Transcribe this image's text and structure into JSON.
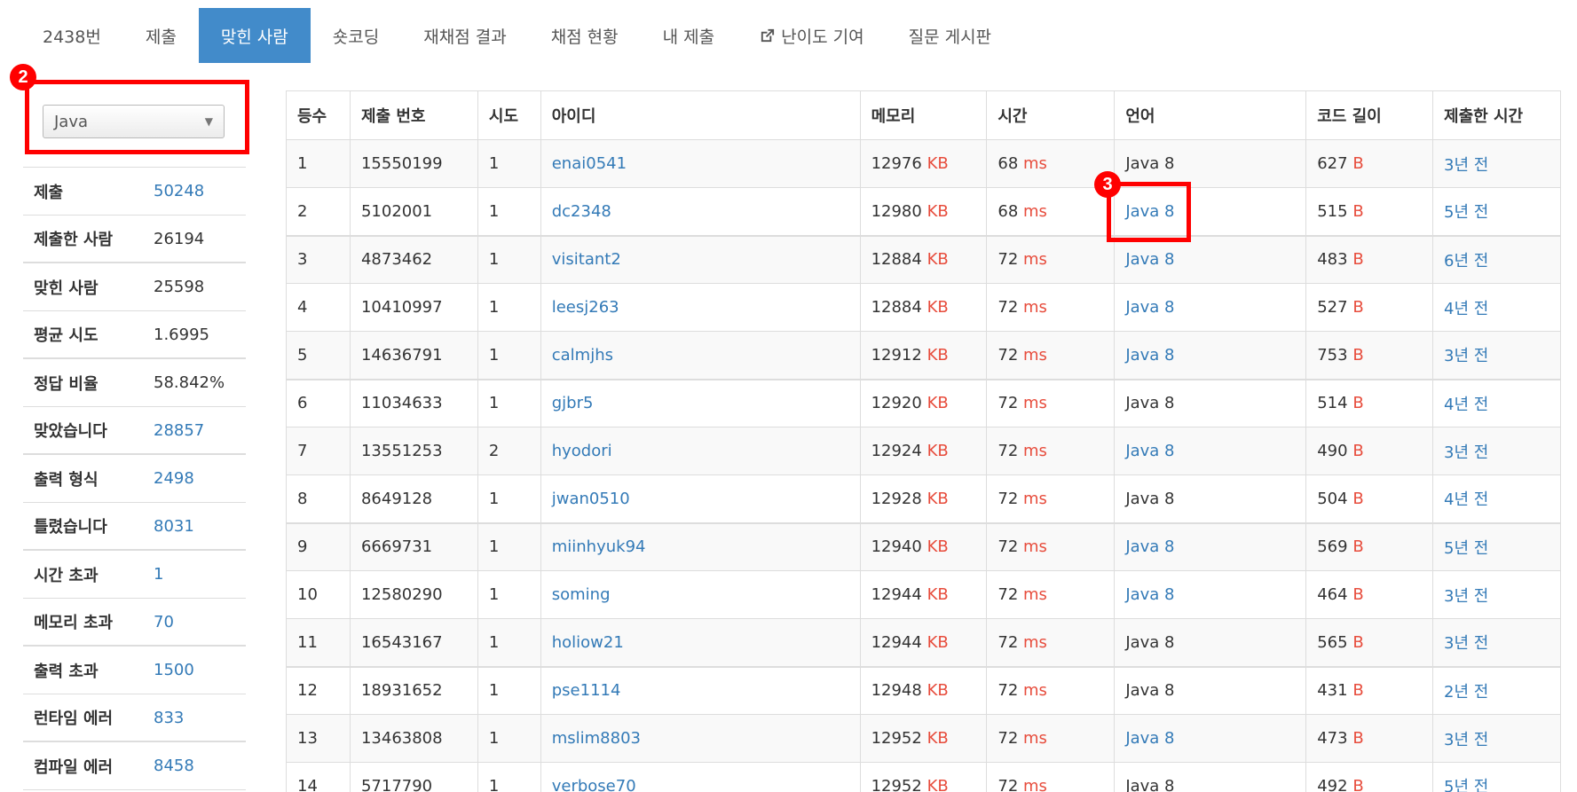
{
  "nav": {
    "tabs": [
      {
        "label": "2438번"
      },
      {
        "label": "제출"
      },
      {
        "label": "맞힌 사람"
      },
      {
        "label": "숏코딩"
      },
      {
        "label": "재채점 결과"
      },
      {
        "label": "채점 현황"
      },
      {
        "label": "내 제출"
      },
      {
        "label": "난이도 기여",
        "icon": "external-link-icon"
      },
      {
        "label": "질문 게시판"
      }
    ],
    "active": "맞힌 사람"
  },
  "language_filter": {
    "selected": "Java"
  },
  "stats": [
    {
      "label": "제출",
      "value": "50248",
      "link": true
    },
    {
      "label": "제출한 사람",
      "value": "26194",
      "link": false
    },
    {
      "label": "맞힌 사람",
      "value": "25598",
      "link": false
    },
    {
      "label": "평균 시도",
      "value": "1.6995",
      "link": false
    },
    {
      "label": "정답 비율",
      "value": "58.842%",
      "link": false
    },
    {
      "label": "맞았습니다",
      "value": "28857",
      "link": true
    },
    {
      "label": "출력 형식",
      "value": "2498",
      "link": true
    },
    {
      "label": "틀렸습니다",
      "value": "8031",
      "link": true
    },
    {
      "label": "시간 초과",
      "value": "1",
      "link": true
    },
    {
      "label": "메모리 초과",
      "value": "70",
      "link": true
    },
    {
      "label": "출력 초과",
      "value": "1500",
      "link": true
    },
    {
      "label": "런타임 에러",
      "value": "833",
      "link": true
    },
    {
      "label": "컴파일 에러",
      "value": "8458",
      "link": true
    }
  ],
  "table": {
    "headers": [
      "등수",
      "제출 번호",
      "시도",
      "아이디",
      "메모리",
      "시간",
      "언어",
      "코드 길이",
      "제출한 시간"
    ],
    "units": {
      "memory": "KB",
      "time": "ms",
      "code": "B"
    },
    "rows": [
      {
        "rank": "1",
        "submission": "15550199",
        "tries": "1",
        "user": "enai0541",
        "memory": "12976",
        "time": "68",
        "lang": "Java 8",
        "lang_link": false,
        "code": "627",
        "when": "3년 전"
      },
      {
        "rank": "2",
        "submission": "5102001",
        "tries": "1",
        "user": "dc2348",
        "memory": "12980",
        "time": "68",
        "lang": "Java 8",
        "lang_link": true,
        "code": "515",
        "when": "5년 전"
      },
      {
        "rank": "3",
        "submission": "4873462",
        "tries": "1",
        "user": "visitant2",
        "memory": "12884",
        "time": "72",
        "lang": "Java 8",
        "lang_link": true,
        "code": "483",
        "when": "6년 전"
      },
      {
        "rank": "4",
        "submission": "10410997",
        "tries": "1",
        "user": "leesj263",
        "memory": "12884",
        "time": "72",
        "lang": "Java 8",
        "lang_link": true,
        "code": "527",
        "when": "4년 전"
      },
      {
        "rank": "5",
        "submission": "14636791",
        "tries": "1",
        "user": "calmjhs",
        "memory": "12912",
        "time": "72",
        "lang": "Java 8",
        "lang_link": true,
        "code": "753",
        "when": "3년 전"
      },
      {
        "rank": "6",
        "submission": "11034633",
        "tries": "1",
        "user": "gjbr5",
        "memory": "12920",
        "time": "72",
        "lang": "Java 8",
        "lang_link": false,
        "code": "514",
        "when": "4년 전"
      },
      {
        "rank": "7",
        "submission": "13551253",
        "tries": "2",
        "user": "hyodori",
        "memory": "12924",
        "time": "72",
        "lang": "Java 8",
        "lang_link": true,
        "code": "490",
        "when": "3년 전"
      },
      {
        "rank": "8",
        "submission": "8649128",
        "tries": "1",
        "user": "jwan0510",
        "memory": "12928",
        "time": "72",
        "lang": "Java 8",
        "lang_link": false,
        "code": "504",
        "when": "4년 전"
      },
      {
        "rank": "9",
        "submission": "6669731",
        "tries": "1",
        "user": "miinhyuk94",
        "memory": "12940",
        "time": "72",
        "lang": "Java 8",
        "lang_link": true,
        "code": "569",
        "when": "5년 전"
      },
      {
        "rank": "10",
        "submission": "12580290",
        "tries": "1",
        "user": "soming",
        "memory": "12944",
        "time": "72",
        "lang": "Java 8",
        "lang_link": true,
        "code": "464",
        "when": "3년 전"
      },
      {
        "rank": "11",
        "submission": "16543167",
        "tries": "1",
        "user": "holiow21",
        "memory": "12944",
        "time": "72",
        "lang": "Java 8",
        "lang_link": false,
        "code": "565",
        "when": "3년 전"
      },
      {
        "rank": "12",
        "submission": "18931652",
        "tries": "1",
        "user": "pse1114",
        "memory": "12948",
        "time": "72",
        "lang": "Java 8",
        "lang_link": false,
        "code": "431",
        "when": "2년 전"
      },
      {
        "rank": "13",
        "submission": "13463808",
        "tries": "1",
        "user": "mslim8803",
        "memory": "12952",
        "time": "72",
        "lang": "Java 8",
        "lang_link": true,
        "code": "473",
        "when": "3년 전"
      },
      {
        "rank": "14",
        "submission": "5717790",
        "tries": "1",
        "user": "verbose70",
        "memory": "12952",
        "time": "72",
        "lang": "Java 8",
        "lang_link": false,
        "code": "492",
        "when": "5년 전"
      }
    ]
  },
  "annotations": [
    {
      "number": "2",
      "color": "#ff0000"
    },
    {
      "number": "3",
      "color": "#ff0000"
    }
  ]
}
